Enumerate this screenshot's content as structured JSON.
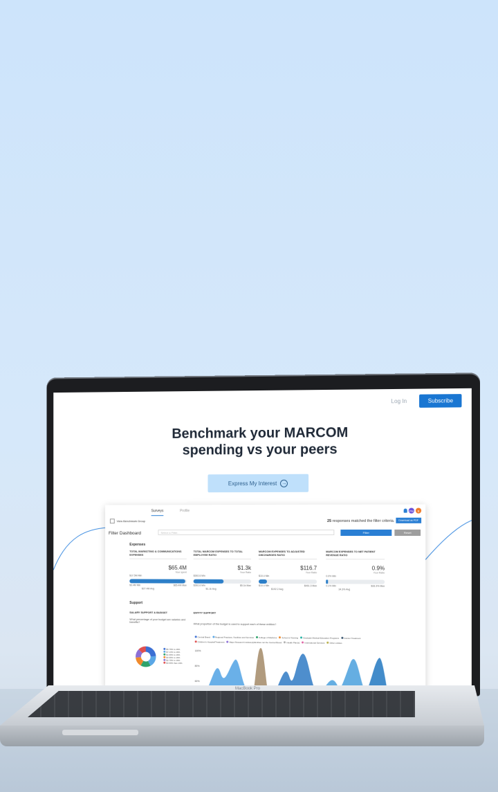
{
  "nav": {
    "login": "Log In",
    "subscribe": "Subscribe"
  },
  "hero": {
    "line1": "Benchmark your MARCOM",
    "line2": "spending vs your peers",
    "cta": "Express My Interest"
  },
  "dashboard": {
    "tabs": [
      "Surveys",
      "Profile"
    ],
    "avatars": [
      "PM",
      "B"
    ],
    "benchmark_label": "View Benchmark Group",
    "matched_count": "25",
    "matched_text": "responses matched the filter criteria.",
    "download": "Download as PDF",
    "filter_title": "Filter Dashboard",
    "filter_placeholder": "Select a Filter...",
    "filter_button": "Filter",
    "reset_button": "Reset",
    "section_expenses": "Expenses",
    "section_support": "Support",
    "cards": [
      {
        "title": "TOTAL MARKETING & COMMUNICATIONS EXPENSES",
        "value": "$65.4M",
        "your": "Your spent",
        "min": "$17.5M Min",
        "max": "$65.4M Max",
        "low": "$3.4M Min",
        "avg": "$27.4M Avg",
        "fill": 0.98
      },
      {
        "title": "TOTAL MARCOM EXPENSES TO TOTAL EMPLOYEE RATIO",
        "value": "$1.3k",
        "your": "Your Ratio",
        "min": "$392.6 Min",
        "max": "$5.1k Max",
        "low": "$392.6 Min",
        "avg": "$1.1k Avg",
        "fill": 0.52
      },
      {
        "title": "MARCOM EXPENSES TO ADJUSTED DISCHARGES RATIO",
        "value": "$116.7",
        "your": "Your Ratio",
        "min": "$10.4 Min",
        "max": "$461.3 Max",
        "low": "$10.4 Min",
        "avg": "$102.2 Avg",
        "fill": 0.14
      },
      {
        "title": "MARCOM EXPENSES TO NET PATIENT REVENUE RATIO",
        "value": "0.9%",
        "your": "Your Ratio",
        "min": "0.0% Min",
        "max": "$33.3% Max",
        "low": "0.1% Min",
        "avg": "34.3% Avg",
        "fill": 0.03
      }
    ],
    "salary_title": "SALARY SUPPORT & BUDGET",
    "salary_question": "What percentage of your budget are salaries and benefits?",
    "entity_title": "ENTITY SUPPORT",
    "entity_question": "What proportion of the budget is used to support each of these entities?",
    "entity_legend": [
      "Central Brand",
      "Regional Practices, Facilities and Services",
      "College of Medicine",
      "School of Nursing",
      "Graduate Medical Education Programs",
      "Cancer Treatment",
      "Children's Hospital/Treatment",
      "Major Research Institute(s)/Entities not the Central Brand",
      "Health Plan(s)",
      "International Services",
      "Other entities"
    ],
    "entity_legend_colors": [
      "#3b6fd4",
      "#5aa7e6",
      "#2ea36b",
      "#f08a2c",
      "#2bb3a6",
      "#3f5a73",
      "#e05050",
      "#8c6fd6",
      "#b0b0b0",
      "#e06aa8",
      "#b8b04a"
    ],
    "y_ticks": [
      "100%",
      "80%",
      "60%"
    ],
    "donut_legend": [
      "$5.79% to 19%",
      "$7.14% to 19%",
      "$1.99% to 19%",
      "$4.99% to 19%",
      "$2.79% to 19%",
      "$3.59% than 19%"
    ],
    "donut_colors": [
      "#3b6fd4",
      "#5aa7e6",
      "#2ea36b",
      "#f08a2c",
      "#8c6fd6",
      "#e05050"
    ],
    "donut_shares": [
      0.24,
      0.18,
      0.16,
      0.15,
      0.14,
      0.13
    ]
  },
  "laptop_brand": "MacBook Pro"
}
